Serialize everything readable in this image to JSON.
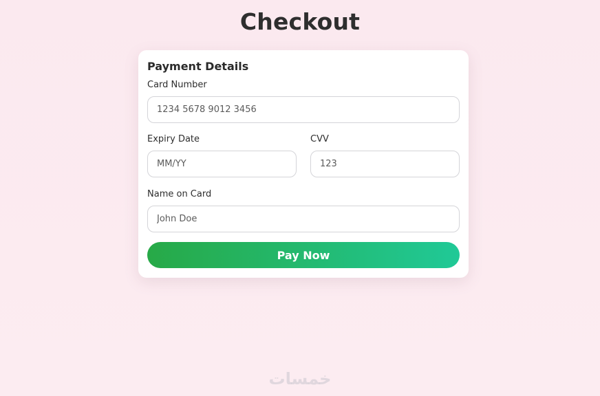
{
  "page": {
    "title": "Checkout"
  },
  "card": {
    "title": "Payment Details",
    "card_number": {
      "label": "Card Number",
      "placeholder": "1234 5678 9012 3456",
      "value": ""
    },
    "expiry": {
      "label": "Expiry Date",
      "placeholder": "MM/YY",
      "value": ""
    },
    "cvv": {
      "label": "CVV",
      "placeholder": "123",
      "value": ""
    },
    "name": {
      "label": "Name on Card",
      "placeholder": "John Doe",
      "value": ""
    },
    "pay_button_label": "Pay Now"
  },
  "watermark": {
    "text": "خمسات"
  },
  "colors": {
    "button_gradient_start": "#27a947",
    "button_gradient_end": "#20c997",
    "background": "#fbe9ef"
  }
}
